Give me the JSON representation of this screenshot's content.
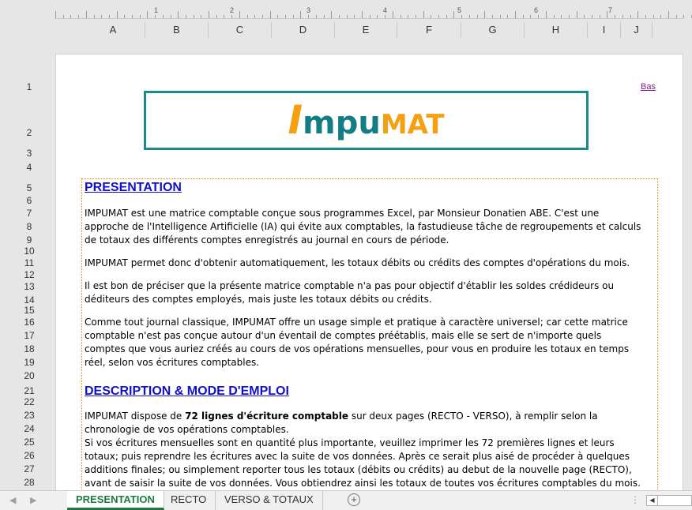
{
  "ruler": {
    "marks": [
      "1",
      "2",
      "3",
      "4",
      "5",
      "6",
      "7"
    ]
  },
  "columns": [
    "A",
    "B",
    "C",
    "D",
    "E",
    "F",
    "G",
    "H",
    "I",
    "J"
  ],
  "rows": [
    "1",
    "2",
    "3",
    "4",
    "5",
    "6",
    "7",
    "8",
    "9",
    "10",
    "11",
    "12",
    "13",
    "14",
    "15",
    "16",
    "17",
    "18",
    "19",
    "20",
    "21",
    "22",
    "23",
    "24",
    "25",
    "26",
    "27",
    "28"
  ],
  "bas_link": "Bas",
  "logo": {
    "i": "I",
    "mpu": "mpu",
    "mat": "MAT"
  },
  "presentation": {
    "heading": "PRESENTATION",
    "p1": "IMPUMAT est une matrice comptable conçue sous programmes Excel, par Monsieur Donatien ABE. C'est une approche de l'Intelligence Artificielle (IA) qui évite aux comptables, la fastudieuse tâche de regroupements et calculs de totaux des différents comptes enregistrés au journal en cours de période.",
    "p2": "IMPUMAT permet donc d'obtenir automatiquement, les totaux débits ou crédits des comptes d'opérations du mois.",
    "p3": "Il est bon de préciser que la présente matrice comptable n'a pas pour objectif d'établir les soldes crédideurs ou déditeurs des comptes employés, mais juste les totaux débits ou crédits.",
    "p4": "Comme tout journal classique, IMPUMAT offre un usage simple et pratique à caractère universel; car cette matrice comptable n'est pas conçue autour d'un éventail de comptes préétablis, mais elle se sert de n'importe quels comptes que vous auriez créés au cours de vos opérations mensuelles, pour vous en produire les totaux en temps réel, selon vos écritures comptables."
  },
  "description": {
    "heading": "DESCRIPTION & MODE D'EMPLOI",
    "p1_start": "IMPUMAT dispose de ",
    "p1_bold": "72 lignes d'écriture comptable",
    "p1_end": " sur deux pages (RECTO - VERSO), à remplir selon la chronologie de vos opérations comptables.",
    "p2": "Si vos écritures mensuelles sont en quantité plus importante, veuillez imprimer les 72 premières lignes et leurs totaux; puis reprendre les écritures avec la suite de vos données. Après ce serait plus aisé de procéder à quelques additions finales; ou simplement reporter tous les totaux (débits ou crédits) au debut de la nouvelle page (RECTO), avant de saisir la suite de vos données. Vous obtiendrez ainsi les totaux de toutes vos écritures comptables du mois."
  },
  "tabs": {
    "t1": "PRESENTATION",
    "t2": "RECTO",
    "t3": "VERSO & TOTAUX",
    "add": "+"
  },
  "colors": {
    "accent_green": "#1e7b3d",
    "logo_teal": "#137d84",
    "logo_orange": "#f5a010",
    "heading_blue": "#1010c8"
  }
}
